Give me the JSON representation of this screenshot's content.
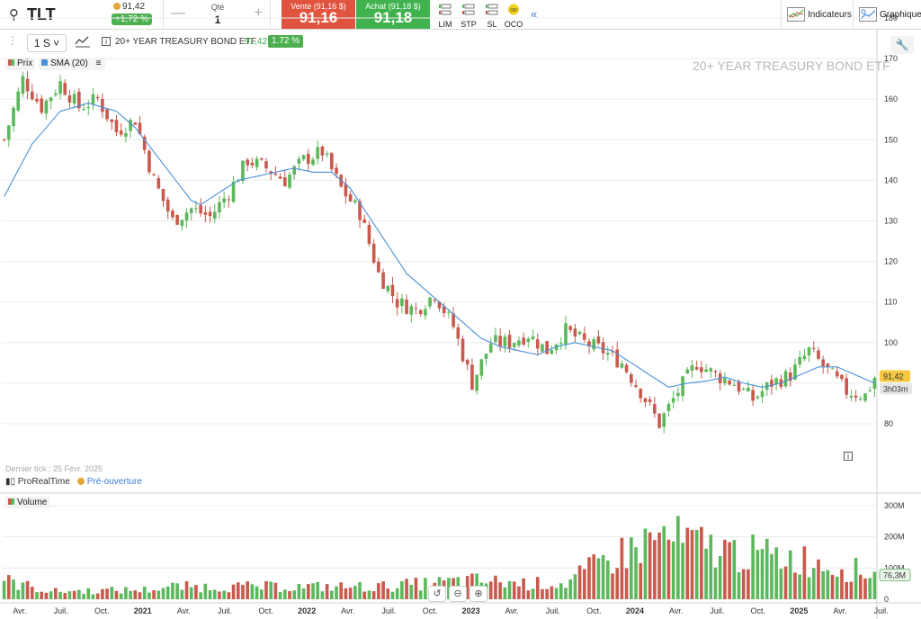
{
  "toolbar": {
    "symbol": "TLT",
    "price": "91,42",
    "change": "+1,72 %",
    "qty_label": "Qté",
    "qty_value": "1",
    "sell_label": "Vente (91,16 $)",
    "sell_value": "91,16",
    "buy_label": "Achat (91,18 $)",
    "buy_value": "91,18",
    "orders": [
      "LIM",
      "STP",
      "SL",
      "OCO"
    ],
    "indicators_label": "Indicateurs",
    "graph_label": "Graphique"
  },
  "chart_header": {
    "period": "1 S",
    "instrument": "20+ YEAR TREASURY BOND ETF",
    "last": "91,42",
    "change": "1.72 %"
  },
  "legend": {
    "price": "Prix",
    "sma": "SMA (20)",
    "volume": "Volume"
  },
  "watermark": "20+ YEAR TREASURY BOND ETF",
  "last_tick": "Dernier tick : 25 Févr. 2025",
  "provider": "ProRealTime",
  "session": "Pré-ouverture",
  "colors": {
    "up": "#5cb85c",
    "down": "#c85a4e",
    "sma": "#4a90d9",
    "grid": "#ececec"
  },
  "chart_data": {
    "type": "candlestick",
    "title": "20+ YEAR TREASURY BOND ETF",
    "price_axis": {
      "ticks": [
        80,
        90,
        100,
        110,
        120,
        130,
        140,
        150,
        160,
        170,
        180
      ],
      "labels": [
        "80",
        "",
        "100",
        "110",
        "120",
        "130",
        "140",
        "150",
        "160",
        "170",
        "180"
      ],
      "range": [
        78,
        180
      ]
    },
    "volume_axis": {
      "ticks": [
        0,
        100,
        200,
        300
      ],
      "labels": [
        "0",
        "100M",
        "200M",
        "300M"
      ],
      "range": [
        0,
        300
      ]
    },
    "x_labels": [
      "Avr.",
      "Juil.",
      "Oct.",
      "2021",
      "Avr.",
      "Juil.",
      "Oct.",
      "2022",
      "Avr.",
      "Juil.",
      "Oct.",
      "2023",
      "Avr.",
      "Juil.",
      "Oct.",
      "2024",
      "Avr.",
      "Juil.",
      "Oct.",
      "2025",
      "Avr.",
      "Juil."
    ],
    "last_price_badge": "91,42",
    "countdown_badge": "3h03m",
    "last_volume_badge": "76,3M",
    "price_path": [
      [
        0,
        150
      ],
      [
        4,
        165
      ],
      [
        8,
        158
      ],
      [
        12,
        164
      ],
      [
        16,
        158
      ],
      [
        20,
        160
      ],
      [
        24,
        152
      ],
      [
        28,
        155
      ],
      [
        32,
        140
      ],
      [
        36,
        130
      ],
      [
        40,
        133
      ],
      [
        44,
        131
      ],
      [
        48,
        137
      ],
      [
        52,
        145
      ],
      [
        56,
        143
      ],
      [
        60,
        140
      ],
      [
        64,
        145
      ],
      [
        68,
        147
      ],
      [
        72,
        138
      ],
      [
        76,
        132
      ],
      [
        80,
        117
      ],
      [
        84,
        110
      ],
      [
        88,
        108
      ],
      [
        92,
        112
      ],
      [
        96,
        104
      ],
      [
        100,
        90
      ],
      [
        104,
        100
      ],
      [
        108,
        100
      ],
      [
        112,
        102
      ],
      [
        116,
        98
      ],
      [
        120,
        103
      ],
      [
        124,
        100
      ],
      [
        128,
        98
      ],
      [
        132,
        95
      ],
      [
        136,
        88
      ],
      [
        140,
        80
      ],
      [
        144,
        88
      ],
      [
        148,
        95
      ],
      [
        152,
        92
      ],
      [
        156,
        90
      ],
      [
        160,
        86
      ],
      [
        164,
        90
      ],
      [
        168,
        92
      ],
      [
        172,
        98
      ],
      [
        176,
        93
      ],
      [
        180,
        88
      ],
      [
        184,
        87
      ],
      [
        186,
        91.4
      ]
    ],
    "sma_path": [
      [
        0,
        136
      ],
      [
        6,
        149
      ],
      [
        12,
        157
      ],
      [
        18,
        159
      ],
      [
        24,
        157
      ],
      [
        28,
        153
      ],
      [
        32,
        147
      ],
      [
        36,
        141
      ],
      [
        40,
        135
      ],
      [
        42,
        134
      ],
      [
        46,
        137
      ],
      [
        50,
        140
      ],
      [
        54,
        141
      ],
      [
        58,
        142
      ],
      [
        62,
        143
      ],
      [
        66,
        142
      ],
      [
        70,
        142
      ],
      [
        74,
        138
      ],
      [
        78,
        131
      ],
      [
        82,
        124
      ],
      [
        86,
        117
      ],
      [
        90,
        113
      ],
      [
        94,
        109
      ],
      [
        98,
        105
      ],
      [
        102,
        101
      ],
      [
        106,
        99
      ],
      [
        110,
        98
      ],
      [
        114,
        97
      ],
      [
        118,
        99
      ],
      [
        122,
        100
      ],
      [
        126,
        99
      ],
      [
        130,
        98
      ],
      [
        134,
        95
      ],
      [
        138,
        92
      ],
      [
        142,
        89
      ],
      [
        146,
        90
      ],
      [
        150,
        90.5
      ],
      [
        154,
        91.5
      ],
      [
        158,
        90
      ],
      [
        162,
        89
      ],
      [
        166,
        90
      ],
      [
        170,
        92
      ],
      [
        174,
        94
      ],
      [
        178,
        94
      ],
      [
        182,
        92
      ],
      [
        186,
        90
      ]
    ],
    "volume_profile": [
      [
        0,
        60
      ],
      [
        10,
        25
      ],
      [
        30,
        30
      ],
      [
        36,
        40
      ],
      [
        60,
        40
      ],
      [
        80,
        40
      ],
      [
        100,
        60
      ],
      [
        112,
        50
      ],
      [
        120,
        50
      ],
      [
        128,
        120
      ],
      [
        140,
        200
      ],
      [
        156,
        150
      ],
      [
        170,
        130
      ],
      [
        186,
        80
      ]
    ]
  }
}
